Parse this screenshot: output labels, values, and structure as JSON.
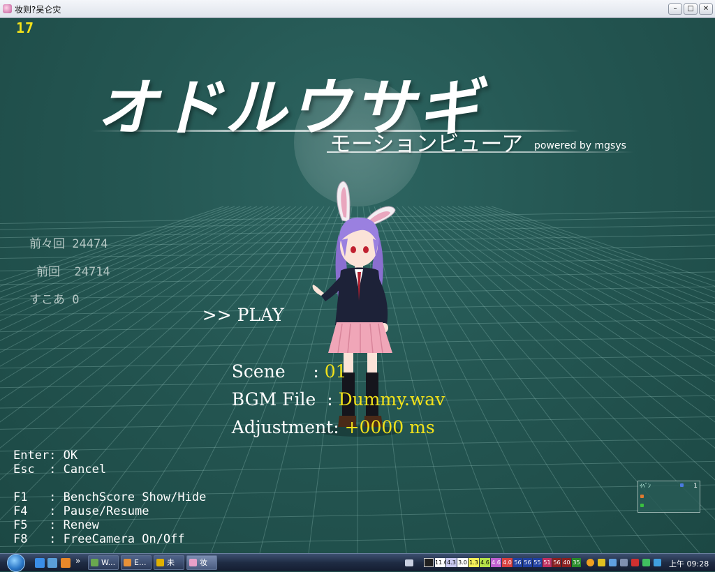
{
  "window": {
    "title": "妆则?吴仑灾",
    "buttons": {
      "minimize": "–",
      "maximize": "□",
      "close": "✕"
    }
  },
  "hud": {
    "fps": "17"
  },
  "logo": {
    "main": "オドルウサギ",
    "sub": "モーションビューア",
    "powered": "powered by mgsys"
  },
  "scores": [
    {
      "label": "前々回",
      "value": "24474"
    },
    {
      "label": "前回",
      "value": "24714"
    },
    {
      "label": "すこあ",
      "value": "0"
    }
  ],
  "menu": {
    "cursor": ">>",
    "play": "PLAY",
    "rows": [
      {
        "label": "Scene     ",
        "sep": ":",
        "value": "01"
      },
      {
        "label": "BGM File  ",
        "sep": ":",
        "value": "Dummy.wav"
      },
      {
        "label": "Adjustment",
        "sep": ":",
        "value": "+0000 ms"
      }
    ]
  },
  "help": [
    "Enter: OK",
    "Esc  : Cancel",
    "",
    "F1   : BenchScore Show/Hide",
    "F4   : Pause/Resume",
    "F5   : Renew",
    "F8   : FreeCamera On/Off"
  ],
  "minimap": {
    "head": "ｲﾍﾞﾝ",
    "count": "1"
  },
  "taskbar": {
    "tasks": [
      {
        "label": "W...",
        "icon_color": "#6aa84f"
      },
      {
        "label": "E...",
        "icon_color": "#e69138"
      },
      {
        "label": "未",
        "icon_color": "#e0b000"
      },
      {
        "label": "妆",
        "icon_color": "#e8a0c8"
      }
    ],
    "more": "»",
    "tray": [
      {
        "text": "11.6",
        "bg": "#ffffff",
        "fg": "#000000"
      },
      {
        "text": "4.3",
        "bg": "#c9c9f0",
        "fg": "#000000"
      },
      {
        "text": "3.0",
        "bg": "#ffffff",
        "fg": "#000000"
      },
      {
        "text": "1.3",
        "bg": "#f4ef5a",
        "fg": "#000000"
      },
      {
        "text": "4.6",
        "bg": "#b7e24a",
        "fg": "#000000"
      },
      {
        "text": "4.6",
        "bg": "#c060d0",
        "fg": "#ffffff"
      },
      {
        "text": "4.0",
        "bg": "#d94040",
        "fg": "#ffffff"
      },
      {
        "text": "56",
        "bg": "#2040a0",
        "fg": "#ffffff"
      },
      {
        "text": "56",
        "bg": "#2040a0",
        "fg": "#ffffff"
      },
      {
        "text": "55",
        "bg": "#2040a0",
        "fg": "#ffffff"
      },
      {
        "text": "51",
        "bg": "#c03060",
        "fg": "#ffffff"
      },
      {
        "text": "56",
        "bg": "#8a2020",
        "fg": "#ffffff"
      },
      {
        "text": "40",
        "bg": "#8a2020",
        "fg": "#ffffff"
      },
      {
        "text": "35",
        "bg": "#2a8a2a",
        "fg": "#ffffff"
      }
    ],
    "clock": "上午 09:28"
  }
}
